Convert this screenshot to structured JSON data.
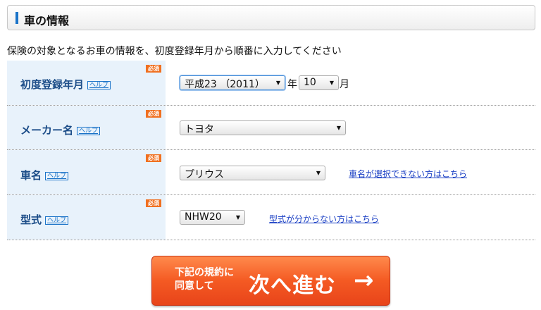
{
  "header": {
    "title": "車の情報"
  },
  "instruction": "保険の対象となるお車の情報を、初度登録年月から順番に入力してください",
  "required_label": "必須",
  "help_label": "ヘルプ",
  "fields": {
    "registration": {
      "label": "初度登録年月",
      "year_value": "平成23 （2011）",
      "year_unit": "年",
      "month_value": "10",
      "month_unit": "月"
    },
    "maker": {
      "label": "メーカー名",
      "value": "トヨタ"
    },
    "car_name": {
      "label": "車名",
      "value": "プリウス",
      "link": "車名が選択できない方はこちら"
    },
    "model": {
      "label": "型式",
      "value": "NHW20",
      "link": "型式が分からない方はこちら"
    }
  },
  "submit": {
    "line1": "下記の規約に",
    "line2": "同意して",
    "main": "次へ進む",
    "arrow": "→"
  },
  "colors": {
    "accent_blue": "#1a73c8",
    "label_bg": "#e8f2fb",
    "required_orange": "#f07020",
    "button_orange": "#f45a23"
  }
}
